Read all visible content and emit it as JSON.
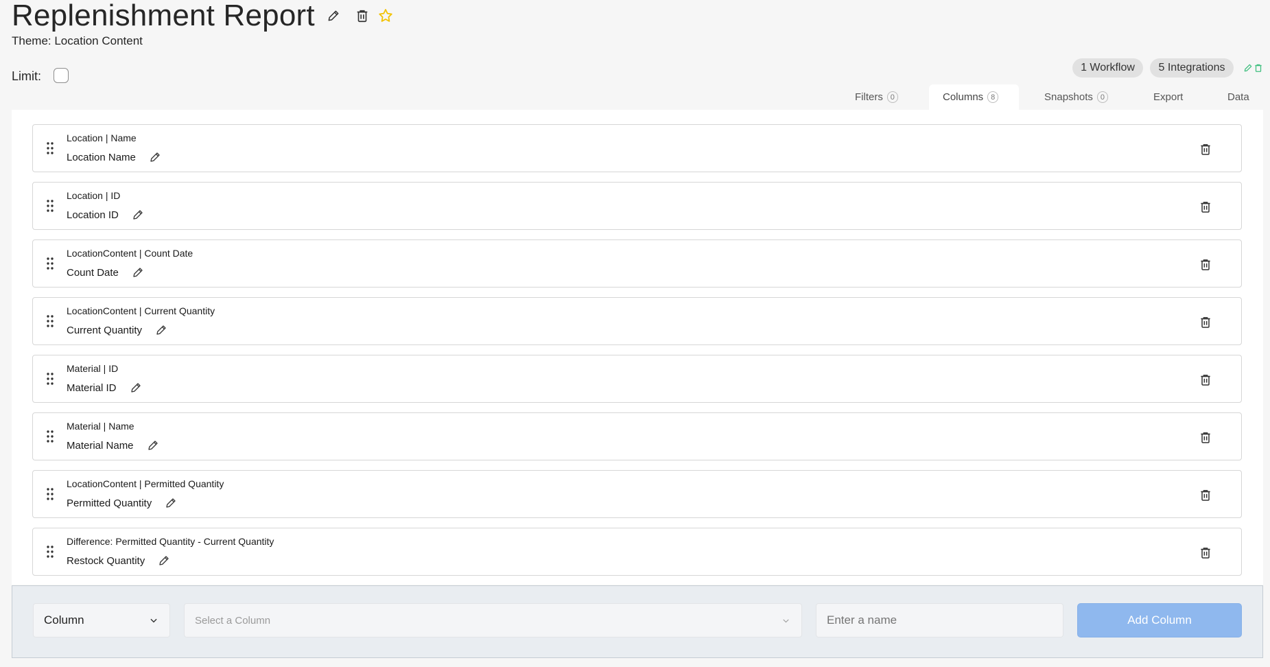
{
  "header": {
    "title": "Replenishment Report",
    "theme": "Theme: Location Content",
    "limit_label": "Limit:"
  },
  "badges": {
    "workflow": "1 Workflow",
    "integrations": "5 Integrations"
  },
  "tabs": [
    {
      "label": "Filters",
      "count": "0"
    },
    {
      "label": "Columns",
      "count": "8"
    },
    {
      "label": "Snapshots",
      "count": "0"
    },
    {
      "label": "Export"
    },
    {
      "label": "Data"
    }
  ],
  "columns": [
    {
      "source": "Location | Name",
      "name": "Location Name"
    },
    {
      "source": "Location | ID",
      "name": "Location ID"
    },
    {
      "source": "LocationContent | Count Date",
      "name": "Count Date"
    },
    {
      "source": "LocationContent | Current Quantity",
      "name": "Current Quantity"
    },
    {
      "source": "Material | ID",
      "name": "Material ID"
    },
    {
      "source": "Material | Name",
      "name": "Material Name"
    },
    {
      "source": "LocationContent | Permitted Quantity",
      "name": "Permitted Quantity"
    },
    {
      "source": "Difference: Permitted Quantity - Current Quantity",
      "name": "Restock Quantity"
    }
  ],
  "footer": {
    "type_value": "Column",
    "select_placeholder": "Select a Column",
    "name_placeholder": "Enter a name",
    "add_label": "Add Column"
  },
  "icons": {
    "title_edit": "pencil-icon",
    "title_delete": "trash-icon",
    "favorite": "star-icon",
    "badge_edit": "pencil-icon",
    "badge_delete": "trash-icon"
  },
  "colors": {
    "star": "#f2c200",
    "badge_icon": "#3fbf7f",
    "add_button": "#8fb8ee"
  }
}
